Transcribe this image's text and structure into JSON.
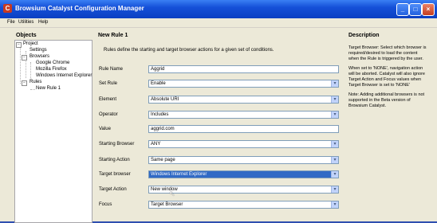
{
  "window": {
    "title": "Browsium Catalyst Configuration Manager",
    "min_glyph": "_",
    "max_glyph": "□",
    "close_glyph": "×",
    "app_icon_glyph": "C"
  },
  "menu": [
    "File",
    "Utilities",
    "Help"
  ],
  "tree": {
    "heading": "Objects",
    "nodes": [
      {
        "label": "Project",
        "toggle": "−"
      },
      {
        "label": "Settings",
        "toggle": ""
      },
      {
        "label": "Browsers",
        "toggle": "−"
      },
      {
        "label": "Google Chrome",
        "toggle": ""
      },
      {
        "label": "Mozilla Firefox",
        "toggle": ""
      },
      {
        "label": "Windows Internet Explorer",
        "toggle": ""
      },
      {
        "label": "Rules",
        "toggle": "−"
      },
      {
        "label": "New Rule 1",
        "toggle": ""
      }
    ]
  },
  "rule": {
    "heading": "New Rule 1",
    "intro": "Rules define the starting and target browser actions for a given set of conditions.",
    "fields": [
      {
        "label": "Rule Name",
        "value": "Aggrid",
        "type": "text"
      },
      {
        "label": "Set Rule",
        "value": "Enable",
        "type": "select"
      },
      {
        "label": "Element",
        "value": "Absolute URI",
        "type": "select"
      },
      {
        "label": "Operator",
        "value": "Includes",
        "type": "select"
      },
      {
        "label": "Value",
        "value": "aggrid.com",
        "type": "text"
      },
      {
        "label": "Starting Browser",
        "value": "ANY",
        "type": "select"
      },
      {
        "label": "Starting Action",
        "value": "Same page",
        "type": "select"
      },
      {
        "label": "Target browser",
        "value": "Windows Internet Explorer",
        "type": "select",
        "selected": true
      },
      {
        "label": "Target Action",
        "value": "New window",
        "type": "select"
      },
      {
        "label": "Focus",
        "value": "Target Browser",
        "type": "select"
      }
    ],
    "dropdown_glyph": "▾"
  },
  "description": {
    "heading": "Description",
    "paragraphs": [
      "Target Browser: Select which browser is required/desired to load the content when the Rule is triggered by the user.",
      "When set to 'NONE', navigation action will be aborted. Catalyst will also ignore Target Action and Focus values when Target Browser is set to 'NONE'",
      "Note: Adding additional browsers is not supported in the Beta version of Browsium Catalyst."
    ]
  },
  "cursor_glyph": "↖"
}
